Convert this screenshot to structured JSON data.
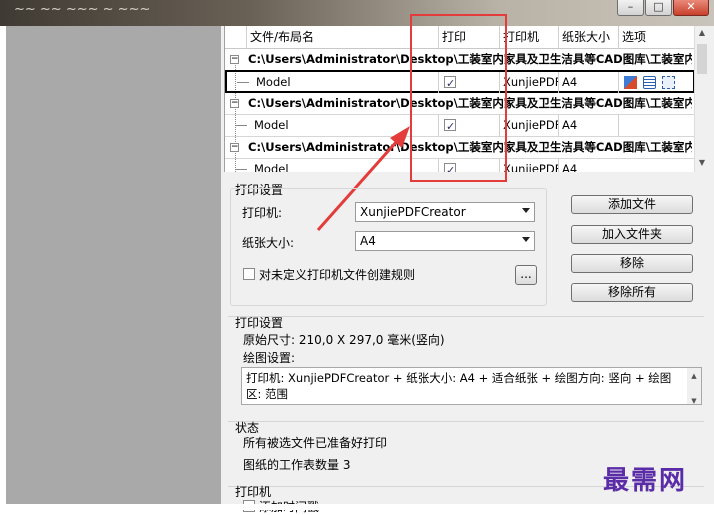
{
  "window": {
    "title_fragment": "~~ ~~ ~~~ ~ ~~~"
  },
  "grid": {
    "columns": [
      "文件/布局名",
      "打印",
      "打印机",
      "纸张大小",
      "选项"
    ],
    "rows": [
      {
        "type": "path",
        "name": "C:\\Users\\Administrator\\Desktop\\工装室内家具及卫生洁具等CAD图库\\工装室内家具及卫生洁具等CAD图库\\工装室内家具及卫生洁具等CAD图库"
      },
      {
        "type": "layout",
        "name": "Model",
        "checked": true,
        "printer": "XunjiePDF",
        "paper": "A4"
      },
      {
        "type": "path",
        "name": "C:\\Users\\Administrator\\Desktop\\工装室内家具及卫生洁具等CAD图库\\工装室内家具及卫生洁具等CAD图库\\工装室内家具及卫生洁具等CAD图库"
      },
      {
        "type": "layout",
        "name": "Model",
        "checked": true,
        "printer": "XunjiePDF",
        "paper": "A4"
      },
      {
        "type": "path",
        "name": "C:\\Users\\Administrator\\Desktop\\工装室内家具及卫生洁具等CAD图库\\工装室内家具及卫生洁具等CAD图库\\工装室内家具及卫生洁具等CAD图库"
      },
      {
        "type": "layout",
        "name": "Model",
        "checked": true,
        "printer": "XunjiePDF",
        "paper": "A4"
      }
    ]
  },
  "print_setup": {
    "title": "打印设置",
    "printer_label": "打印机:",
    "printer_value": "XunjiePDFCreator",
    "paper_label": "纸张大小:",
    "paper_value": "A4",
    "rule_checkbox_label": "对未定义打印机文件创建规则",
    "ellipsis_button": "...",
    "buttons": {
      "add_file": "添加文件",
      "add_folder": "加入文件夹",
      "remove": "移除",
      "remove_all": "移除所有"
    }
  },
  "print_settings": {
    "title": "打印设置",
    "original_size": "原始尺寸: 210,0 X 297,0 毫米(竖向)",
    "plot_settings_label": "绘图设置:",
    "plot_settings_value": "打印机: XunjiePDFCreator + 纸张大小: A4 + 适合纸张 + 绘图方向: 竖向 + 绘图区: 范围"
  },
  "status": {
    "title": "状态",
    "message": "所有被选文件已准备好打印",
    "sheet_count": "图纸的工作表数量 3"
  },
  "printer_section": {
    "title": "打印机",
    "partial_line": "添加时间戳"
  },
  "watermark": "最需网",
  "colors": {
    "highlight": "#e43b3b",
    "watermark": "#5b2ca8",
    "left_pane": "#a9a9a9"
  }
}
